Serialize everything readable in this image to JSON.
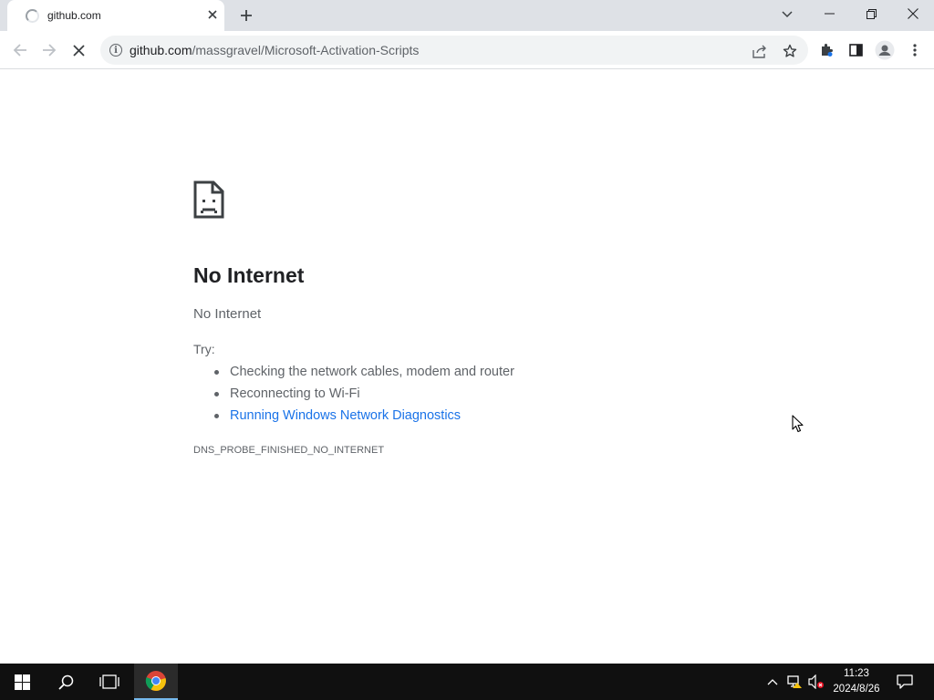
{
  "browser": {
    "tab": {
      "title": "github.com",
      "state": "loading"
    },
    "url": {
      "host": "github.com",
      "path": "/massgravel/Microsoft-Activation-Scripts"
    },
    "icons": {
      "back": "arrow-left-icon",
      "forward": "arrow-right-icon",
      "stop": "close-icon",
      "site_info": "info-icon",
      "share": "share-icon",
      "bookmark": "star-icon",
      "extensions": "puzzle-icon",
      "side_panel": "side-panel-icon",
      "profile": "profile-icon",
      "menu": "more-vert-icon"
    }
  },
  "error_page": {
    "title": "No Internet",
    "subtitle": "No Internet",
    "try_label": "Try:",
    "suggestions": [
      {
        "text": "Checking the network cables, modem and router",
        "is_link": false
      },
      {
        "text": "Reconnecting to Wi-Fi",
        "is_link": false
      },
      {
        "text": "Running Windows Network Diagnostics",
        "is_link": true
      }
    ],
    "error_code": "DNS_PROBE_FINISHED_NO_INTERNET"
  },
  "taskbar": {
    "clock": {
      "time": "11:23",
      "date": "2024/8/26"
    }
  },
  "colors": {
    "link": "#1a73e8",
    "text_primary": "#202124",
    "text_secondary": "#5f6368",
    "tabstrip": "#dee1e6",
    "taskbar": "#101010"
  }
}
